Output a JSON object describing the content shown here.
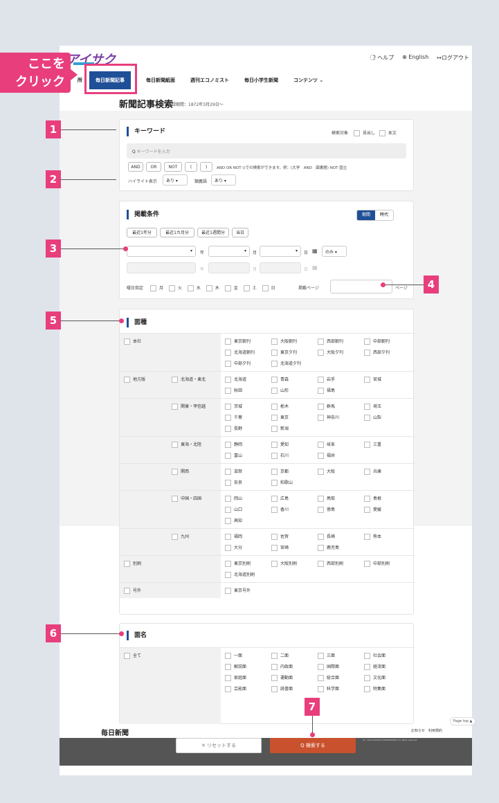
{
  "header": {
    "logo": "アイサク",
    "help": "ヘルプ",
    "language": "English",
    "logout": "ログアウト"
  },
  "nav": {
    "cut_item": "所",
    "items": [
      "毎日新聞記事",
      "毎日新聞紙面",
      "週刊エコノミスト",
      "毎日小学生新聞",
      "コンテンツ ⌄"
    ]
  },
  "callout": {
    "line1": "ここを",
    "line2": "クリック"
  },
  "page": {
    "title": "新聞記事検索",
    "subtitle": "収録期間：1872年3月29日～"
  },
  "keyword": {
    "title": "キーワード",
    "target_label": "検索対象",
    "target_options": [
      "見出し",
      "本文"
    ],
    "placeholder": "キーワードを入力",
    "ops": [
      "AND",
      "OR",
      "NOT",
      "(",
      ")"
    ],
    "help": "AND OR NOT ()での検索ができます。例：(大学　AND　図書館) NOT 国立",
    "highlight_label": "ハイライト表示",
    "highlight_value": "あり",
    "synonym_label": "類義語",
    "synonym_value": "あり"
  },
  "conditions": {
    "title": "掲載条件",
    "toggle": [
      "期間",
      "時代"
    ],
    "quick": [
      "最近1年分",
      "最近1カ月分",
      "最近1週間分",
      "当日"
    ],
    "year": "年",
    "month": "月",
    "day": "日",
    "only": "のみ",
    "weekday_label": "曜日指定",
    "weekdays": [
      "月",
      "火",
      "水",
      "木",
      "金",
      "土",
      "日"
    ],
    "page_label": "掲載ページ",
    "page_unit": "ページ"
  },
  "area": {
    "title": "面種",
    "rows": [
      {
        "l1": "本社",
        "l2": "",
        "items": [
          "東京朝刊",
          "大阪朝刊",
          "西部朝刊",
          "中部朝刊",
          "北海道朝刊",
          "東京夕刊",
          "大阪夕刊",
          "西部夕刊",
          "中部夕刊",
          "北海道夕刊"
        ]
      },
      {
        "l1": "地方版",
        "l2": "北海道・東北",
        "items": [
          "北海道",
          "青森",
          "岩手",
          "宮城",
          "秋田",
          "山形",
          "福島"
        ]
      },
      {
        "l1": "",
        "l2": "関東・甲信越",
        "items": [
          "茨城",
          "栃木",
          "群馬",
          "埼玉",
          "千葉",
          "東京",
          "神奈川",
          "山梨",
          "長野",
          "新潟"
        ]
      },
      {
        "l1": "",
        "l2": "東海・北陸",
        "items": [
          "静岡",
          "愛知",
          "岐阜",
          "三重",
          "富山",
          "石川",
          "福井"
        ]
      },
      {
        "l1": "",
        "l2": "関西",
        "items": [
          "滋賀",
          "京都",
          "大阪",
          "兵庫",
          "奈良",
          "和歌山"
        ]
      },
      {
        "l1": "",
        "l2": "中国・四国",
        "items": [
          "岡山",
          "広島",
          "鳥取",
          "島根",
          "山口",
          "香川",
          "徳島",
          "愛媛",
          "高知"
        ]
      },
      {
        "l1": "",
        "l2": "九州",
        "items": [
          "福岡",
          "佐賀",
          "長崎",
          "熊本",
          "大分",
          "宮崎",
          "鹿児島"
        ]
      },
      {
        "l1": "別刷",
        "l2": "",
        "items": [
          "東京別刷",
          "大阪別刷",
          "西部別刷",
          "中部別刷",
          "北海道別刷"
        ]
      },
      {
        "l1": "号外",
        "l2": "",
        "items": [
          "東京号外"
        ]
      }
    ]
  },
  "men": {
    "title": "面名",
    "all": "全て",
    "items": [
      "一面",
      "二面",
      "三面",
      "社会面",
      "解説面",
      "内政面",
      "国際面",
      "経済面",
      "家庭面",
      "運動面",
      "総合面",
      "文化面",
      "芸能面",
      "読書面",
      "科学面",
      "特集面"
    ]
  },
  "badges": [
    "1",
    "2",
    "3",
    "4",
    "5",
    "6",
    "7"
  ],
  "footer": {
    "logo": "毎日新聞",
    "links": "お知らせ　利用規約",
    "reset": "✕ リセットする",
    "search": "Q 検索する",
    "copy": "（C）2024 MAINICHI NEWSPAPERS All rights reserved.",
    "pagetop": "Page top ▲"
  },
  "colors": {
    "accent": "#e83e7c",
    "brand": "#1f4f96",
    "search": "#c9512e"
  }
}
